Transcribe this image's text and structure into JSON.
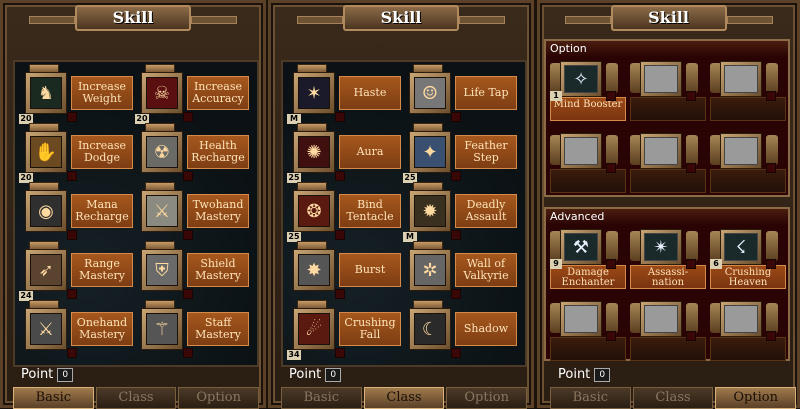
{
  "panels": [
    {
      "title": "Skill",
      "skills": [
        {
          "label": "Increase Weight",
          "level": "20",
          "glyph": "♞",
          "bg": "#1b2a20"
        },
        {
          "label": "Increase Accuracy",
          "level": "20",
          "glyph": "☠",
          "bg": "#5a1010"
        },
        {
          "label": "Increase Dodge",
          "level": "20",
          "glyph": "✋",
          "bg": "#6b4a22"
        },
        {
          "label": "Health Recharge",
          "level": "",
          "glyph": "☢",
          "bg": "#6a6a66"
        },
        {
          "label": "Mana Recharge",
          "level": "",
          "glyph": "◉",
          "bg": "#2f2f2f"
        },
        {
          "label": "Twohand Mastery",
          "level": "",
          "glyph": "⚔",
          "bg": "#8a8a80"
        },
        {
          "label": "Range Mastery",
          "level": "24",
          "glyph": "➶",
          "bg": "#5a4430"
        },
        {
          "label": "Shield Mastery",
          "level": "",
          "glyph": "⛨",
          "bg": "#6a6a6a"
        },
        {
          "label": "Onehand Mastery",
          "level": "",
          "glyph": "⚔",
          "bg": "#4a4a4a"
        },
        {
          "label": "Staff Mastery",
          "level": "",
          "glyph": "⚚",
          "bg": "#555"
        }
      ],
      "point_label": "Point",
      "point_value": "0",
      "tabs": [
        "Basic",
        "Class",
        "Option"
      ],
      "active_tab": 0
    },
    {
      "title": "Skill",
      "skills": [
        {
          "label": "Haste",
          "level": "M",
          "glyph": "✶",
          "bg": "#1a1a2a"
        },
        {
          "label": "Life Tap",
          "level": "",
          "glyph": "☺",
          "bg": "#777"
        },
        {
          "label": "Aura",
          "level": "25",
          "glyph": "✺",
          "bg": "#401010"
        },
        {
          "label": "Feather Step",
          "level": "25",
          "glyph": "✦",
          "bg": "#3a5070"
        },
        {
          "label": "Bind Tentacle",
          "level": "25",
          "glyph": "❂",
          "bg": "#5a1a10"
        },
        {
          "label": "Deadly Assault",
          "level": "M",
          "glyph": "✹",
          "bg": "#3a3020"
        },
        {
          "label": "Burst",
          "level": "",
          "glyph": "✸",
          "bg": "#555"
        },
        {
          "label": "Wall of Valkyrie",
          "level": "",
          "glyph": "✲",
          "bg": "#666"
        },
        {
          "label": "Crushing Fall",
          "level": "34",
          "glyph": "☄",
          "bg": "#5a1a10"
        },
        {
          "label": "Shadow",
          "level": "",
          "glyph": "☾",
          "bg": "#2a2a2a"
        }
      ],
      "point_label": "Point",
      "point_value": "0",
      "tabs": [
        "Basic",
        "Class",
        "Option"
      ],
      "active_tab": 1
    },
    {
      "title": "Skill",
      "option_header": "Option",
      "advanced_header": "Advanced",
      "option_slots": [
        {
          "label": "Mind Booster",
          "level": "1",
          "glyph": "✧",
          "active": true
        },
        {
          "label": "",
          "level": "",
          "active": false
        },
        {
          "label": "",
          "level": "",
          "active": false
        },
        {
          "label": "",
          "level": "",
          "active": false
        },
        {
          "label": "",
          "level": "",
          "active": false
        },
        {
          "label": "",
          "level": "",
          "active": false
        }
      ],
      "advanced_slots": [
        {
          "label": "Damage Enchanter",
          "level": "9",
          "glyph": "⚒",
          "active": true
        },
        {
          "label": "Assassi- nation",
          "level": "",
          "glyph": "✴",
          "active": true
        },
        {
          "label": "Crushing Heaven",
          "level": "6",
          "glyph": "☇",
          "active": true
        },
        {
          "label": "",
          "level": "",
          "active": false
        },
        {
          "label": "",
          "level": "",
          "active": false
        },
        {
          "label": "",
          "level": "",
          "active": false
        }
      ],
      "point_label": "Point",
      "point_value": "0",
      "tabs": [
        "Basic",
        "Class",
        "Option"
      ],
      "active_tab": 2
    }
  ]
}
